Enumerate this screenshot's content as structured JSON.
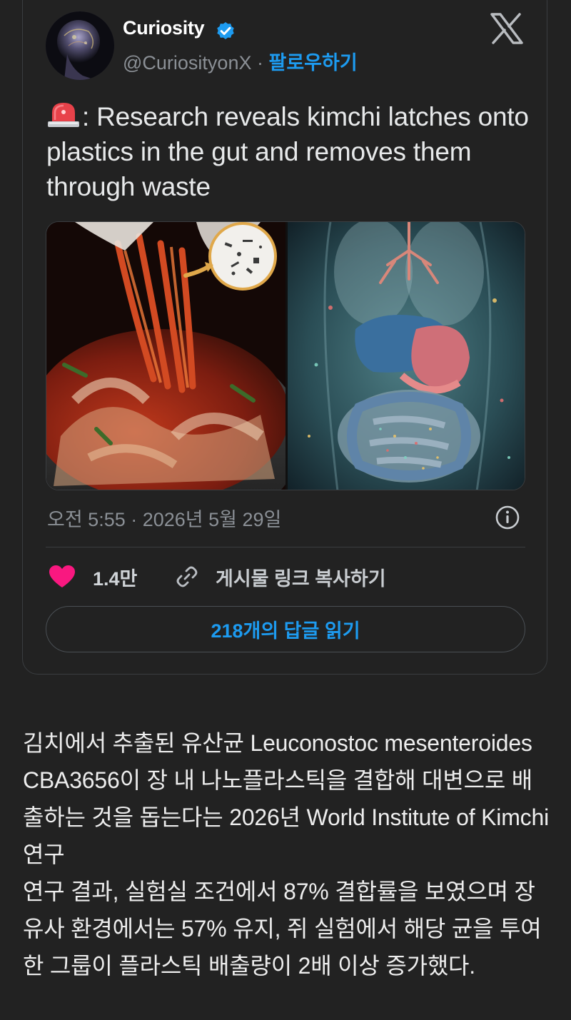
{
  "tweet": {
    "display_name": "Curiosity",
    "handle": "@CuriosityonX",
    "handle_separator": " · ",
    "follow_label": "팔로우하기",
    "verified": true,
    "avatar_icon": "brain-head-avatar",
    "brand_logo": "x-logo",
    "text_icon": "siren-emoji-icon",
    "text": ": Research reveals kimchi latches onto plastics in the gut and removes them through waste",
    "timestamp": "오전 5:55 · 2026년 5월 29일",
    "likes": "1.4만",
    "copy_link_label": "게시물 링크 복사하기",
    "replies_button_label": "218개의 답글 읽기",
    "media": [
      {
        "name": "kimchi-photo"
      },
      {
        "name": "gut-microplastics-illustration"
      }
    ]
  },
  "article": {
    "paragraph_1": "김치에서 추출된 유산균 Leuconostoc mesenteroides CBA3656이 장 내 나노플라스틱을 결합해 대변으로 배출하는 것을 돕는다는 2026년 World Institute of Kimchi 연구",
    "paragraph_2": "연구 결과, 실험실 조건에서 87% 결합률을 보였으며 장 유사 환경에서는 57% 유지, 쥐 실험에서 해당 균을 투여한 그룹이 플라스틱 배출량이 2배 이상 증가했다."
  },
  "colors": {
    "background": "#222222",
    "accent": "#1d9bf0",
    "heart": "#f91880",
    "muted_text": "#8b9096",
    "border": "#3a3d40"
  }
}
